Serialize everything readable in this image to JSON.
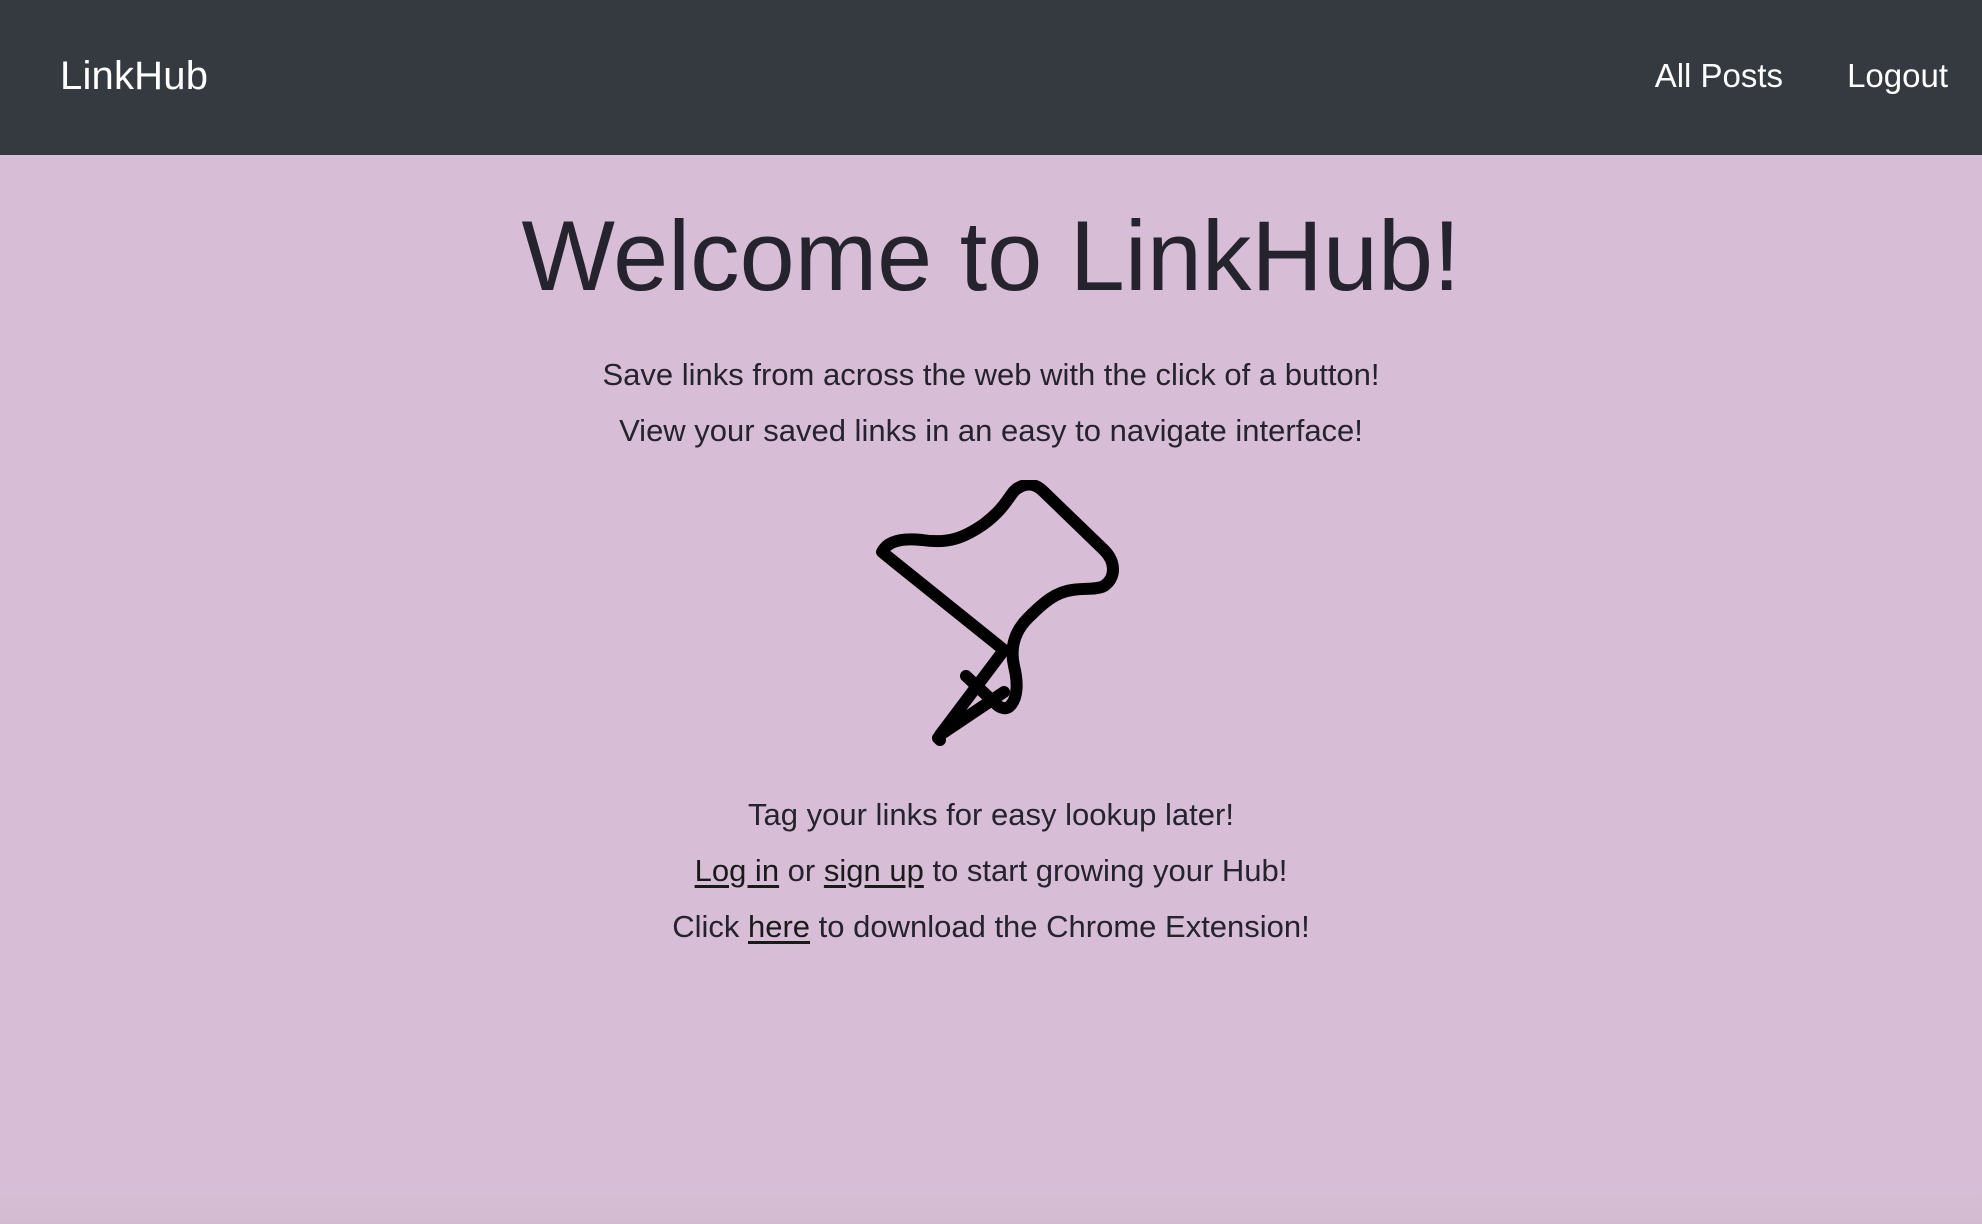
{
  "nav": {
    "brand": "LinkHub",
    "links": [
      "All Posts",
      "Logout"
    ]
  },
  "main": {
    "title": "Welcome to LinkHub!",
    "intro_lines": [
      "Save links from across the web with the click of a button!",
      "View your saved links in an easy to navigate interface!"
    ],
    "pin_icon": "pushpin-icon",
    "tag_line": "Tag your links for easy lookup later!",
    "auth_line": {
      "login_link": "Log in",
      "or_text": " or ",
      "signup_link": "sign up",
      "suffix": " to start growing your Hub!"
    },
    "download_line": {
      "prefix": "Click ",
      "here_link": "here",
      "suffix": " to download the Chrome Extension!"
    }
  },
  "colors": {
    "navbar_bg": "#343a40",
    "page_bg": "#d7bed6",
    "text": "#25232d"
  }
}
